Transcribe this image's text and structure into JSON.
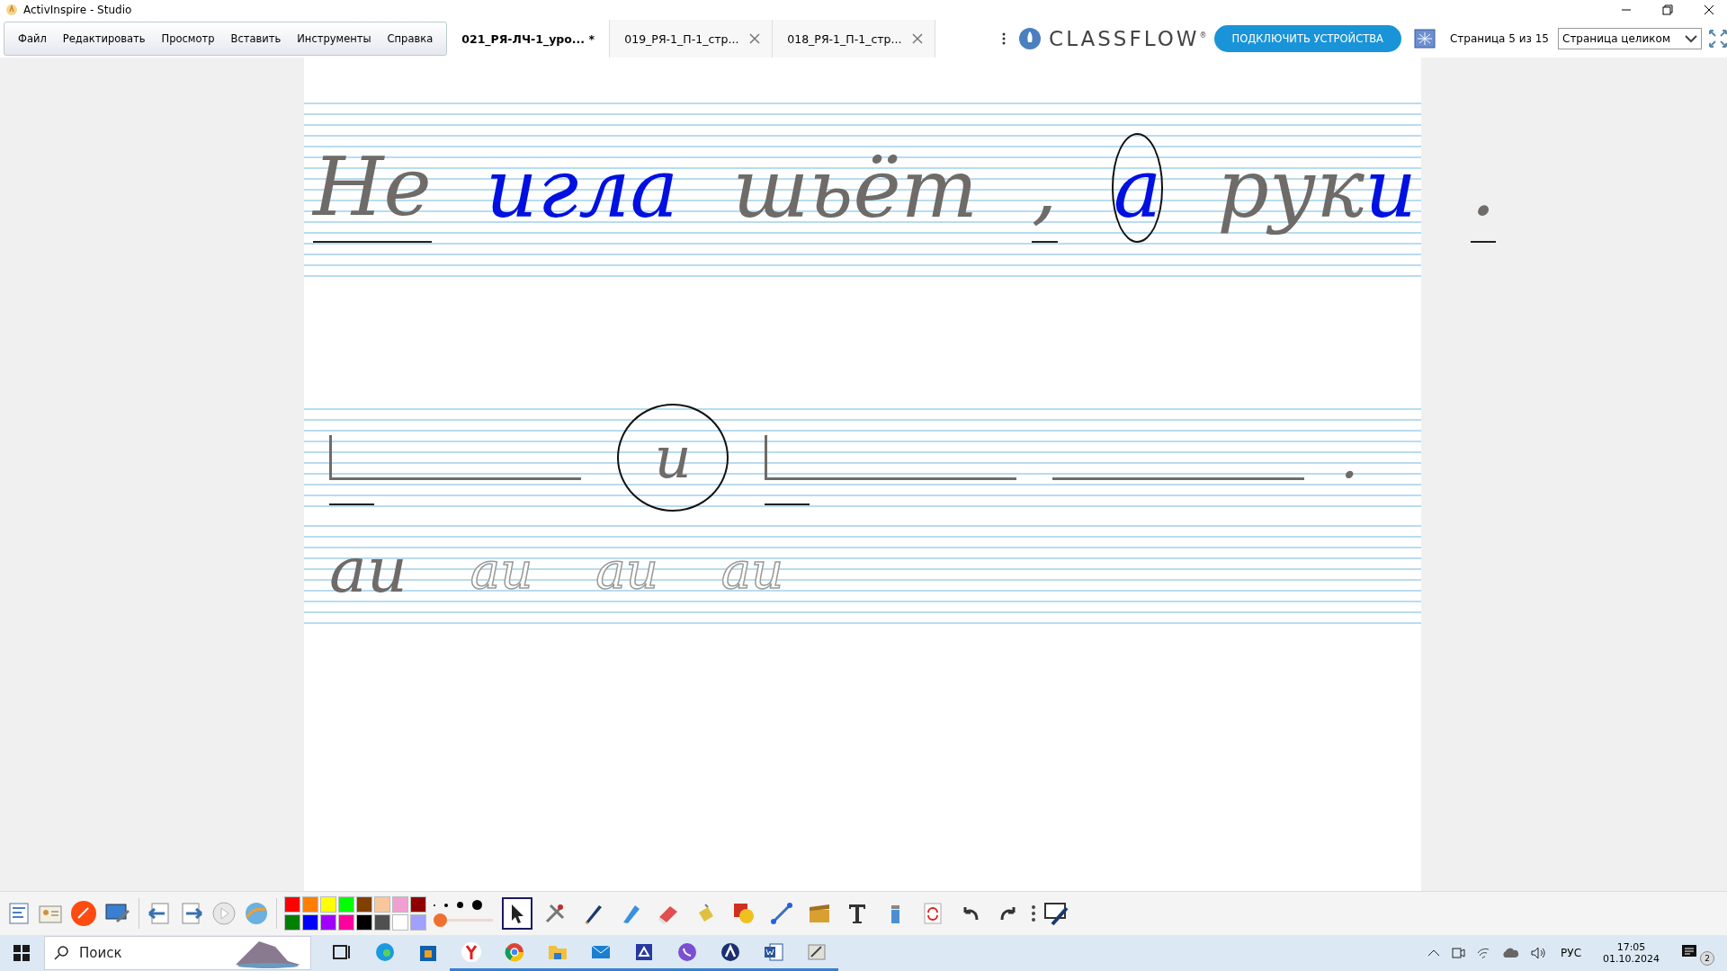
{
  "window": {
    "title": "ActivInspire - Studio"
  },
  "menu": [
    "Файл",
    "Редактировать",
    "Просмотр",
    "Вставить",
    "Инструменты",
    "Справка"
  ],
  "tabs": [
    {
      "label": "021_РЯ-ЛЧ-1_уро... *",
      "selected": true
    },
    {
      "label": "019_РЯ-1_П-1_стр...",
      "selected": false
    },
    {
      "label": "018_РЯ-1_П-1_стр...",
      "selected": false
    }
  ],
  "classflow": {
    "logo": "CLASSFLOW",
    "mark": "®",
    "button": "ПОДКЛЮЧИТЬ УСТРОЙСТВА"
  },
  "page_counter": "Страница 5 из 15",
  "zoom": {
    "value": "Страница целиком"
  },
  "sentence": [
    {
      "parts": [
        {
          "text": "Не",
          "color": "#6e6b68"
        }
      ],
      "circled": false,
      "underlined": true
    },
    {
      "parts": [
        {
          "text": "игла",
          "color": "#0010e0"
        }
      ],
      "circled": false,
      "underlined": false
    },
    {
      "parts": [
        {
          "text": "шьёт",
          "color": "#6e6b68"
        }
      ],
      "circled": false,
      "underlined": false
    },
    {
      "parts": [
        {
          "text": ",",
          "color": "#6e6b68"
        }
      ],
      "circled": false,
      "underlined": true
    },
    {
      "parts": [
        {
          "text": "а",
          "color": "#0010e0"
        }
      ],
      "circled": true,
      "underlined": false
    },
    {
      "parts": [
        {
          "text": "рук",
          "color": "#6e6b68"
        },
        {
          "text": "и",
          "color": "#0010e0"
        }
      ],
      "circled": false,
      "underlined": false
    },
    {
      "parts": [
        {
          "text": ".",
          "color": "#6e6b68"
        }
      ],
      "circled": false,
      "underlined": true
    }
  ],
  "pen_size": {
    "level": 0.0
  },
  "scheme": [
    {
      "kind": "blank",
      "start": true,
      "underlined": true
    },
    {
      "kind": "letter",
      "text": "и",
      "circled": true
    },
    {
      "kind": "blank",
      "start": true,
      "underlined": true
    },
    {
      "kind": "blank",
      "start": false,
      "underlined": false
    },
    {
      "kind": "letter",
      "text": ".",
      "circled": false
    }
  ],
  "practice": [
    {
      "text": "аи",
      "dotted": false
    },
    {
      "text": "аи",
      "dotted": true
    },
    {
      "text": "аи",
      "dotted": true
    },
    {
      "text": "аи",
      "dotted": true
    }
  ],
  "palette": [
    {
      "color": "#ff0000"
    },
    {
      "color": "#ff8000"
    },
    {
      "color": "#ffff00"
    },
    {
      "color": "#00ff00"
    },
    {
      "color": "#804000"
    },
    {
      "color": "#f8c89c"
    },
    {
      "color": "#f0a0d0"
    },
    {
      "color": "#900000"
    },
    {
      "color": "#008000"
    },
    {
      "color": "#0000ff"
    },
    {
      "color": "#a000ff"
    },
    {
      "color": "#ff00a0"
    },
    {
      "color": "#000000"
    },
    {
      "color": "#505050"
    },
    {
      "color": "#ffffff"
    },
    {
      "color": "#a0a0ff"
    }
  ],
  "tools": [
    {
      "selected": true
    },
    {
      "selected": false
    },
    {
      "selected": false
    },
    {
      "selected": false
    },
    {
      "selected": false
    },
    {
      "selected": false
    },
    {
      "selected": false
    },
    {
      "selected": false
    },
    {
      "selected": false
    },
    {
      "selected": false
    },
    {
      "selected": false
    },
    {
      "selected": false
    },
    {
      "selected": false
    },
    {
      "selected": false
    }
  ],
  "taskbar": {
    "search": {
      "placeholder": "Поиск"
    },
    "language": "РУС",
    "time": "17:05",
    "date": "01.10.2024",
    "notifications": "2"
  }
}
